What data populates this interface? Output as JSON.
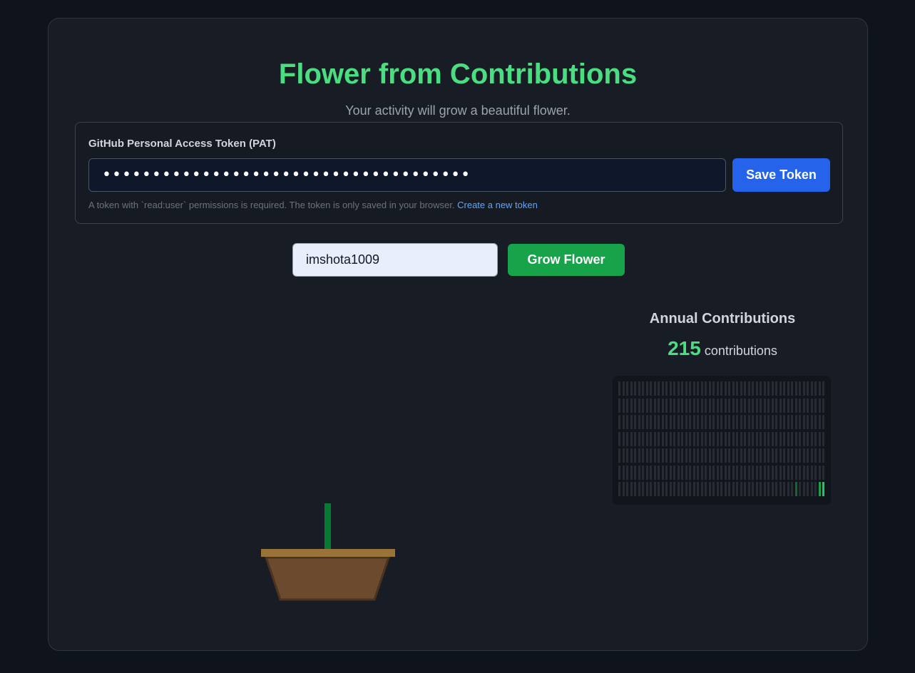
{
  "header": {
    "title": "Flower from Contributions",
    "subtitle": "Your activity will grow a beautiful flower."
  },
  "token": {
    "label": "GitHub Personal Access Token (PAT)",
    "value": "•••••••••••••••••••••••••••••••••••••",
    "save_label": "Save Token",
    "help_text": "A token with `read:user` permissions is required. The token is only saved in your browser.",
    "help_link": "Create a new token"
  },
  "user": {
    "username": "imshota1009",
    "grow_label": "Grow Flower"
  },
  "contributions": {
    "title": "Annual Contributions",
    "total": "215",
    "unit": "contributions",
    "weeks": 53,
    "days": 7,
    "active_cells": [
      {
        "week": 45,
        "day": 6,
        "level": 1
      },
      {
        "week": 51,
        "day": 6,
        "level": 2
      },
      {
        "week": 52,
        "day": 6,
        "level": 3
      }
    ]
  },
  "colors": {
    "accent_green": "#4ade80",
    "button_blue": "#2563eb",
    "button_green": "#16a34a",
    "pot": "#6b4a2e",
    "pot_rim": "#9a7338",
    "stem": "#047a33"
  }
}
